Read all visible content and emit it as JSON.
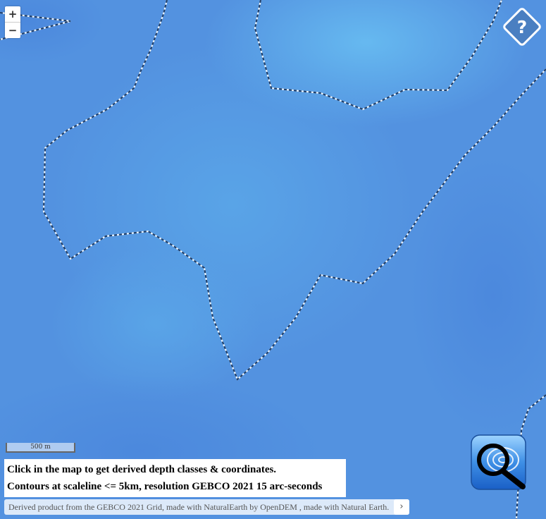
{
  "map": {
    "colors": {
      "deep": "#5090e0",
      "shallow": "#66b9f0",
      "mid": "#5aa2e6",
      "contour_dark": "#1f3f6b",
      "contour_light": "#e9f2fb"
    }
  },
  "zoom": {
    "in_label": "+",
    "out_label": "−",
    "in_icon": "plus-icon",
    "out_icon": "minus-icon"
  },
  "help": {
    "label": "?",
    "icon": "help-diamond-icon"
  },
  "scale": {
    "label": "500 m"
  },
  "info": {
    "line1": "Click in the map to get derived depth classes & coordinates.",
    "line2": "Contours at scaleline <= 5km, resolution GEBCO 2021 15 arc-seconds"
  },
  "attribution": {
    "text": "Derived product from the GEBCO 2021 Grid, made with NaturalEarth by OpenDEM , made with Natural Earth.",
    "toggle_label": "›"
  },
  "search": {
    "icon": "magnifier-icon"
  }
}
